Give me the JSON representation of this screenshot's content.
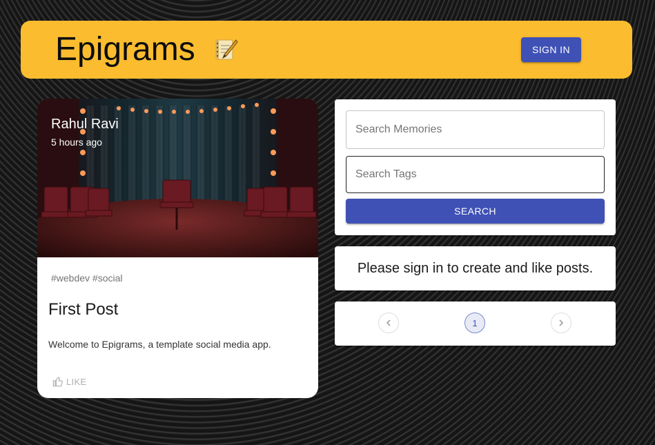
{
  "appbar": {
    "title": "Epigrams",
    "icon": "memo-notepad-icon",
    "sign_in_label": "SIGN IN",
    "bg_color": "#fbbc2f"
  },
  "post": {
    "author": "Rahul Ravi",
    "time": "5 hours ago",
    "tags": "#webdev #social",
    "title": "First Post",
    "message": "Welcome to Epigrams, a template social media app.",
    "like_label": "LIKE",
    "image": "theater-stage-chairs-image"
  },
  "search": {
    "memories_placeholder": "Search Memories",
    "tags_placeholder": "Search Tags",
    "button_label": "SEARCH"
  },
  "info": {
    "text": "Please sign in to create and like posts."
  },
  "pagination": {
    "current_page": "1"
  },
  "colors": {
    "primary": "#3f51b5",
    "accent": "#fbbc2f",
    "background": "#151515"
  }
}
